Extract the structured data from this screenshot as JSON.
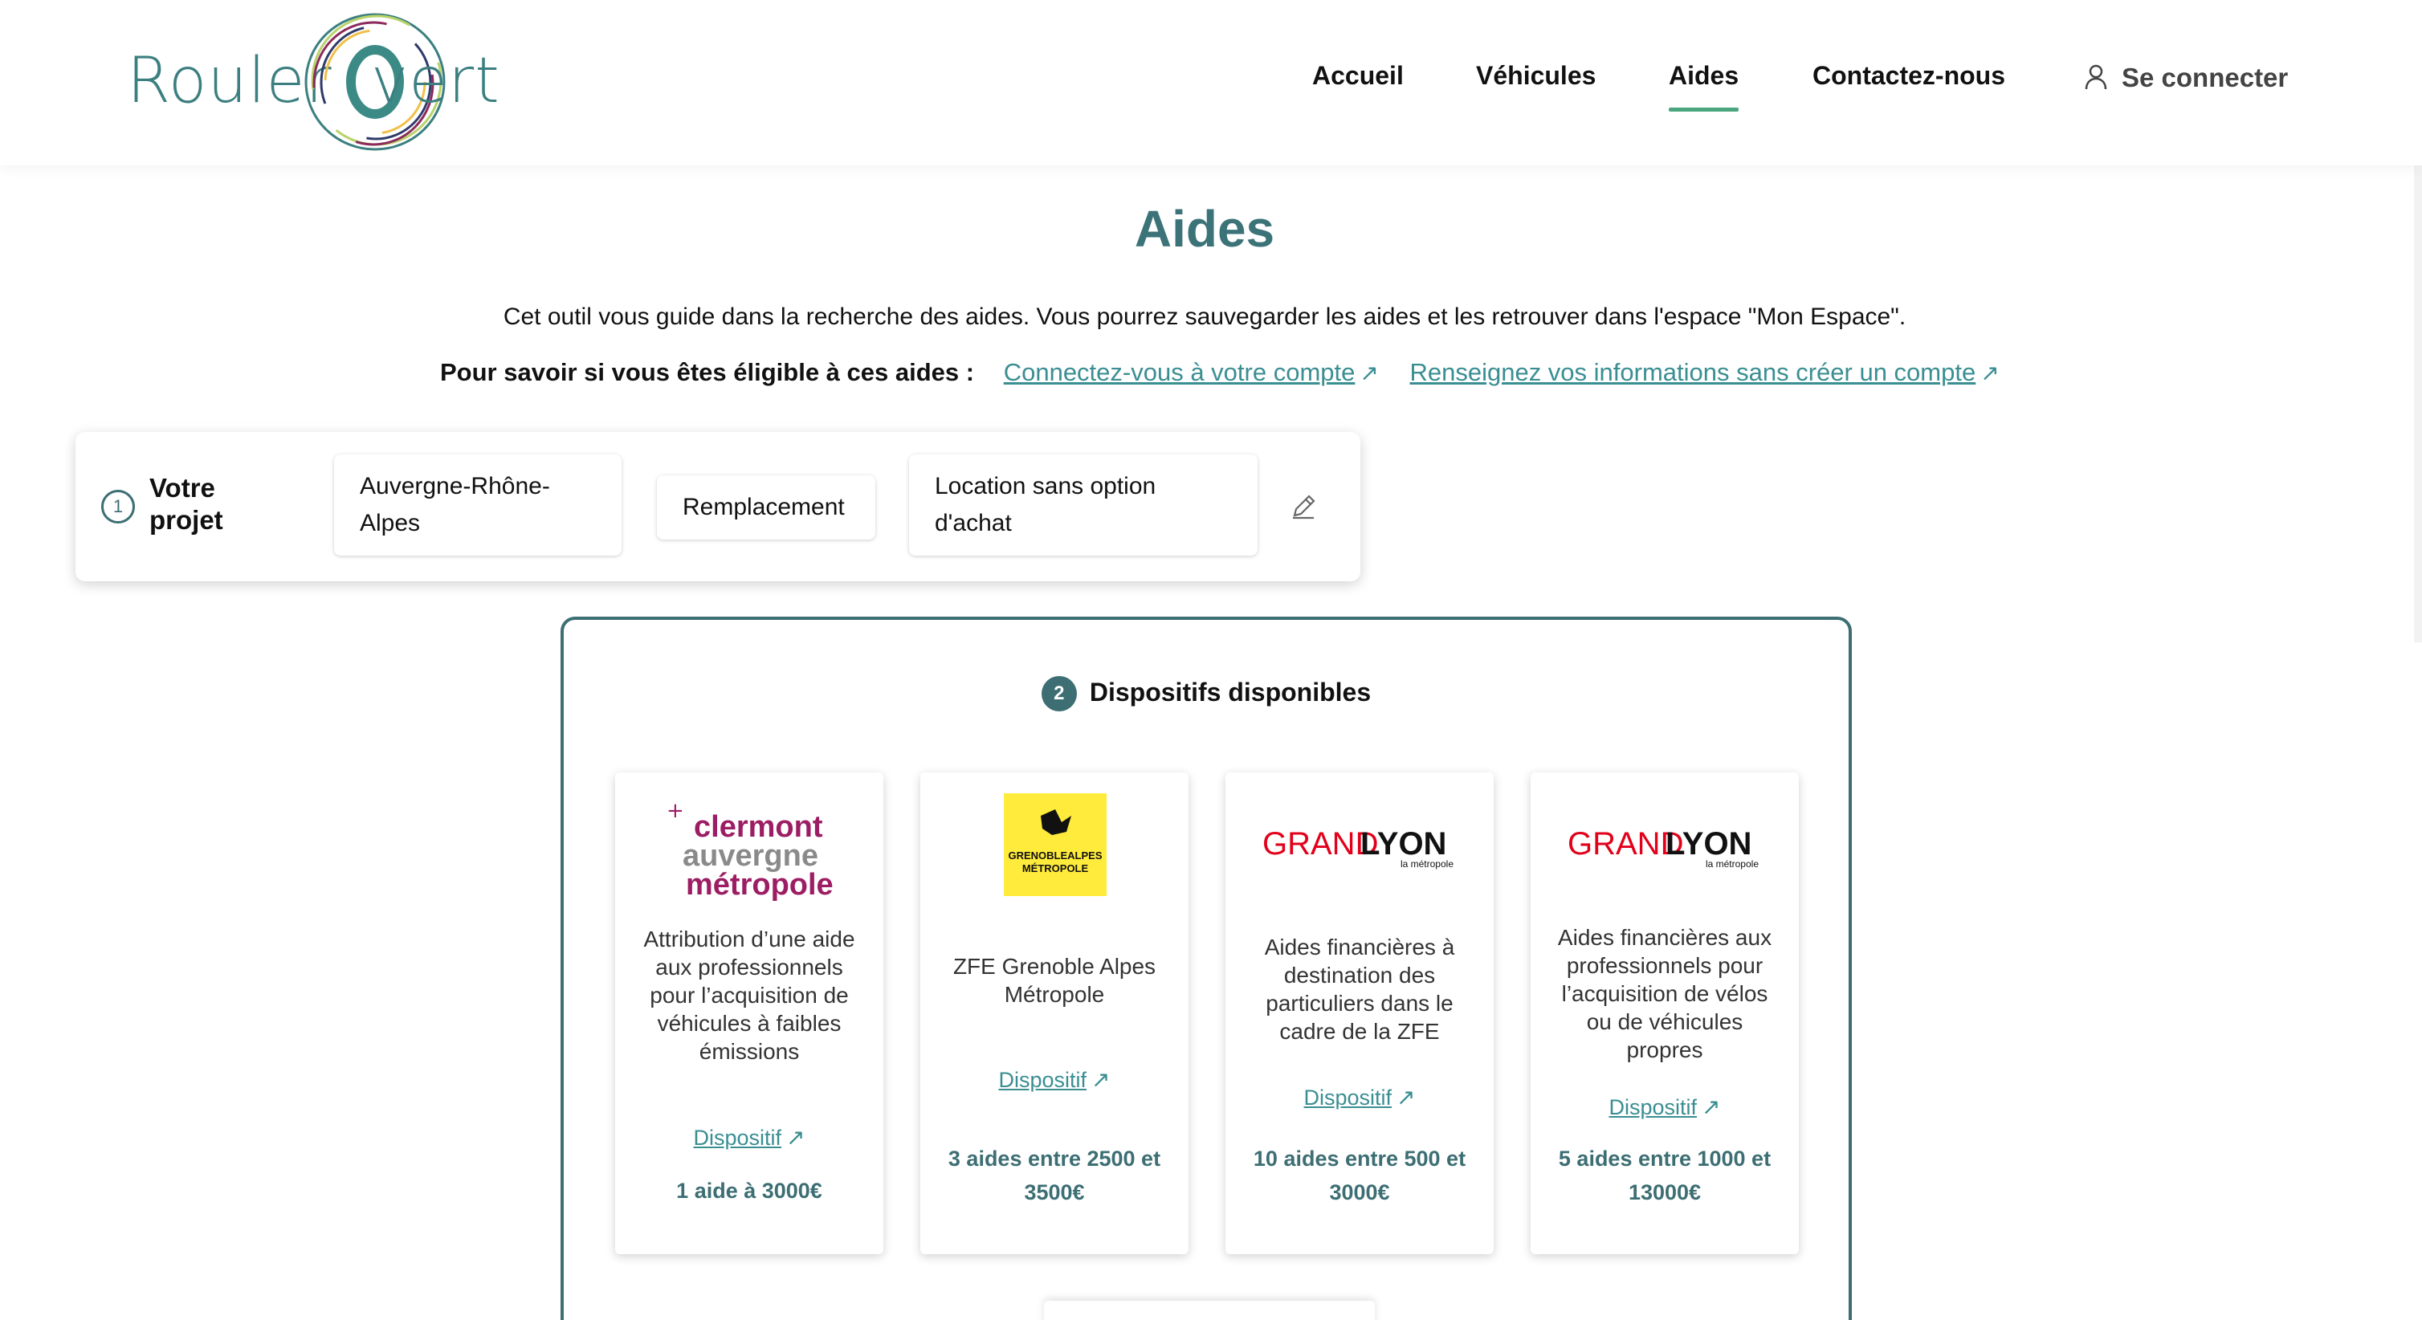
{
  "brand": {
    "logo_text_left": "Rouler",
    "logo_text_right": "vert"
  },
  "nav": {
    "items": [
      {
        "label": "Accueil"
      },
      {
        "label": "Véhicules"
      },
      {
        "label": "Aides",
        "active": true
      },
      {
        "label": "Contactez-nous"
      }
    ],
    "login_label": "Se connecter"
  },
  "page": {
    "title": "Aides",
    "intro": "Cet outil vous guide dans la recherche des aides. Vous pourrez sauvegarder les aides et les retrouver dans l'espace \"Mon Espace\".",
    "eligibility_label": "Pour savoir si vous êtes éligible à ces aides :",
    "link_login": "Connectez-vous à votre compte",
    "link_info": "Renseignez vos informations sans créer un compte"
  },
  "project": {
    "step": "1",
    "label": "Votre projet",
    "region": "Auvergne-Rhône-Alpes",
    "type": "Remplacement",
    "financing": "Location sans option d'achat"
  },
  "dispositifs": {
    "step": "2",
    "title": "Dispositifs disponibles",
    "cards": [
      {
        "logo": "clermont-auvergne-metropole-logo",
        "logo_lines": [
          "clermont",
          "auvergne",
          "métropole"
        ],
        "description": "Attribution d’une aide aux professionnels pour l’acquisition de véhicules à faibles émissions",
        "link": "Dispositif",
        "amount": "1 aide à 3000€"
      },
      {
        "logo": "grenoble-alpes-metropole-logo",
        "logo_lines": [
          "GRENOBLEALPES",
          "MÉTROPOLE"
        ],
        "description": "ZFE Grenoble Alpes Métropole",
        "link": "Dispositif",
        "amount": "3 aides entre 2500 et 3500€"
      },
      {
        "logo": "grand-lyon-logo",
        "logo_lines": [
          "GRAND",
          "LYON",
          "la métropole"
        ],
        "description": "Aides financières à destination des particuliers dans le cadre de la ZFE",
        "link": "Dispositif",
        "amount": "10 aides entre 500 et 3000€"
      },
      {
        "logo": "grand-lyon-logo",
        "logo_lines": [
          "GRAND",
          "LYON",
          "la métropole"
        ],
        "description": "Aides financières aux professionnels pour l’acquisition de vélos ou de véhicules propres",
        "link": "Dispositif",
        "amount": "5 aides entre 1000 et 13000€"
      }
    ]
  },
  "colors": {
    "primary": "#3c6e73",
    "link": "#3a8e92",
    "accent": "#4aa67c",
    "lyon_red": "#e2001a",
    "clermont": "#9c1d63",
    "grenoble_yellow": "#ffeb3b"
  }
}
